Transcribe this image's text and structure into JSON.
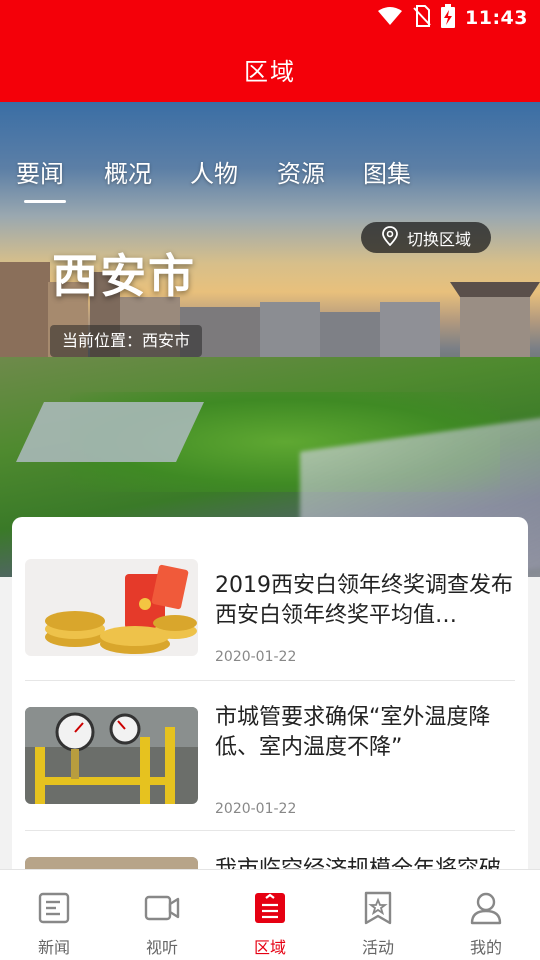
{
  "status_bar": {
    "time": "11:43",
    "icons": [
      "wifi-icon",
      "no-sim-icon",
      "battery-charging-icon"
    ]
  },
  "header": {
    "title": "区域"
  },
  "tabs": [
    {
      "label": "要闻",
      "active": true
    },
    {
      "label": "概况",
      "active": false
    },
    {
      "label": "人物",
      "active": false
    },
    {
      "label": "资源",
      "active": false
    },
    {
      "label": "图集",
      "active": false
    }
  ],
  "hero": {
    "city_name": "西安市",
    "location_text": "当前位置：西安市",
    "switch_label": "切换区域",
    "switch_icon": "location-pin-icon"
  },
  "news": [
    {
      "title": "2019西安白领年终奖调查发布 西安白领年终奖平均值…",
      "date": "2020-01-22",
      "thumb": "red-envelope-coins"
    },
    {
      "title": "市城管要求确保“室外温度降低、室内温度不降”",
      "date": "2020-01-22",
      "thumb": "pressure-gauges"
    },
    {
      "title": "我市临空经济规模全年将突破",
      "date": "",
      "thumb": "city-skyline"
    }
  ],
  "bottom_nav": [
    {
      "label": "新闻",
      "icon": "news-icon",
      "active": false
    },
    {
      "label": "视听",
      "icon": "video-icon",
      "active": false
    },
    {
      "label": "区域",
      "icon": "region-icon",
      "active": true
    },
    {
      "label": "活动",
      "icon": "activity-icon",
      "active": false
    },
    {
      "label": "我的",
      "icon": "profile-icon",
      "active": false
    }
  ],
  "colors": {
    "brand_red": "#f40009",
    "active_nav": "#e60012"
  }
}
